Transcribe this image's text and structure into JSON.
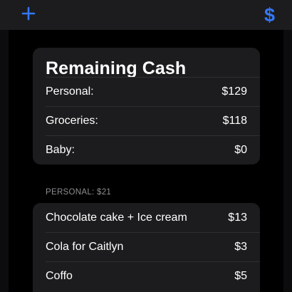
{
  "nav": {
    "add_icon": "plus-icon",
    "currency_label": "$",
    "accent_color": "#3478f6"
  },
  "summary": {
    "title": "Remaining Cash",
    "rows": [
      {
        "label": "Personal:",
        "value": "$129"
      },
      {
        "label": "Groceries:",
        "value": "$118"
      },
      {
        "label": "Baby:",
        "value": "$0"
      }
    ]
  },
  "section": {
    "header": "PERSONAL: $21"
  },
  "expenses": [
    {
      "label": "Chocolate cake + Ice cream",
      "value": "$13"
    },
    {
      "label": "Cola for Caitlyn",
      "value": "$3"
    },
    {
      "label": "Coffo",
      "value": "$5"
    }
  ],
  "colors": {
    "background": "#000000",
    "card": "#1c1c1e",
    "text": "#ffffff",
    "secondary_text": "#8e8e93"
  }
}
